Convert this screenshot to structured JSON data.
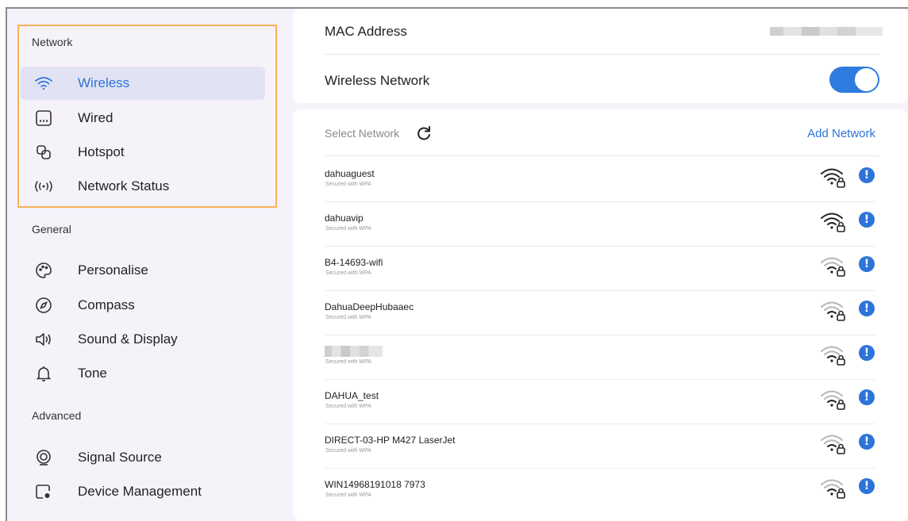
{
  "sidebar": {
    "sections": [
      {
        "title": "Network",
        "items": [
          {
            "label": "Wireless",
            "icon": "wifi-icon",
            "active": true
          },
          {
            "label": "Wired",
            "icon": "ethernet-icon"
          },
          {
            "label": "Hotspot",
            "icon": "hotspot-icon"
          },
          {
            "label": "Network Status",
            "icon": "network-status-icon"
          }
        ]
      },
      {
        "title": "General",
        "items": [
          {
            "label": "Personalise",
            "icon": "palette-icon"
          },
          {
            "label": "Compass",
            "icon": "compass-icon"
          },
          {
            "label": "Sound & Display",
            "icon": "speaker-icon"
          },
          {
            "label": "Tone",
            "icon": "bell-icon"
          }
        ]
      },
      {
        "title": "Advanced",
        "items": [
          {
            "label": "Signal Source",
            "icon": "signal-source-icon"
          },
          {
            "label": "Device Management",
            "icon": "device-settings-icon"
          }
        ]
      }
    ]
  },
  "main": {
    "mac_label": "MAC Address",
    "wireless_label": "Wireless Network",
    "wireless_enabled": true,
    "select_network_label": "Select Network",
    "add_network_label": "Add Network",
    "networks": [
      {
        "name": "dahuaguest",
        "security": "Secured with WPA",
        "strength": "strong"
      },
      {
        "name": "dahuavip",
        "security": "Secured with WPA",
        "strength": "strong"
      },
      {
        "name": "B4-14693-wifi",
        "security": "Secured with WPA",
        "strength": "weak"
      },
      {
        "name": "DahuaDeepHubaaec",
        "security": "Secured with WPA",
        "strength": "weak"
      },
      {
        "name": "",
        "security": "Secured with WPA",
        "strength": "weak",
        "redacted": true
      },
      {
        "name": "DAHUA_test",
        "security": "Secured with WPA",
        "strength": "weak"
      },
      {
        "name": "DIRECT-03-HP M427 LaserJet",
        "security": "Secured with WPA",
        "strength": "weak"
      },
      {
        "name": "WIN14968191018 7973",
        "security": "Secured with WPA",
        "strength": "weak"
      }
    ]
  },
  "colors": {
    "accent": "#2d74d8",
    "highlight": "#f6b35a",
    "background": "#f6f2fa"
  }
}
